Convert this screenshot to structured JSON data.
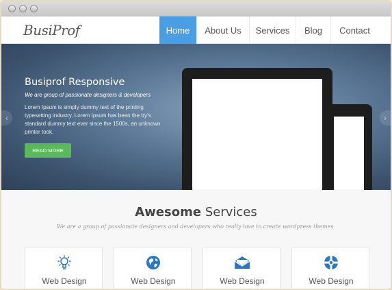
{
  "brand": {
    "logo": "BusiProf"
  },
  "nav": {
    "items": [
      "Home",
      "About Us",
      "Services",
      "Blog",
      "Contact"
    ],
    "active": "Home"
  },
  "hero": {
    "title": "Busiprof Responsive",
    "subtitle": "We are group of passionate designers & developers",
    "text": "Lorem Ipsum is simply dummy text of the printing typesetting industry. Lorem Ipsum has been the try's standard dummy text ever since the 1500s, an unknown printer took.",
    "button": "READ MORE",
    "prev_arrow": "‹",
    "next_arrow": "›"
  },
  "services": {
    "heading_bold": "Awesome",
    "heading_rest": " Services",
    "tagline": "We are a group of passionate designers and developers who really love to create  wordpress themes.",
    "cards": [
      {
        "icon": "lightbulb-icon",
        "label": "Web Design"
      },
      {
        "icon": "globe-icon",
        "label": "Web Design"
      },
      {
        "icon": "envelope-icon",
        "label": "Web Design"
      },
      {
        "icon": "lifebuoy-icon",
        "label": "Web Design"
      }
    ]
  },
  "colors": {
    "accent": "#4a9ee3",
    "button": "#5cb85c",
    "icon": "#2a78c0"
  }
}
